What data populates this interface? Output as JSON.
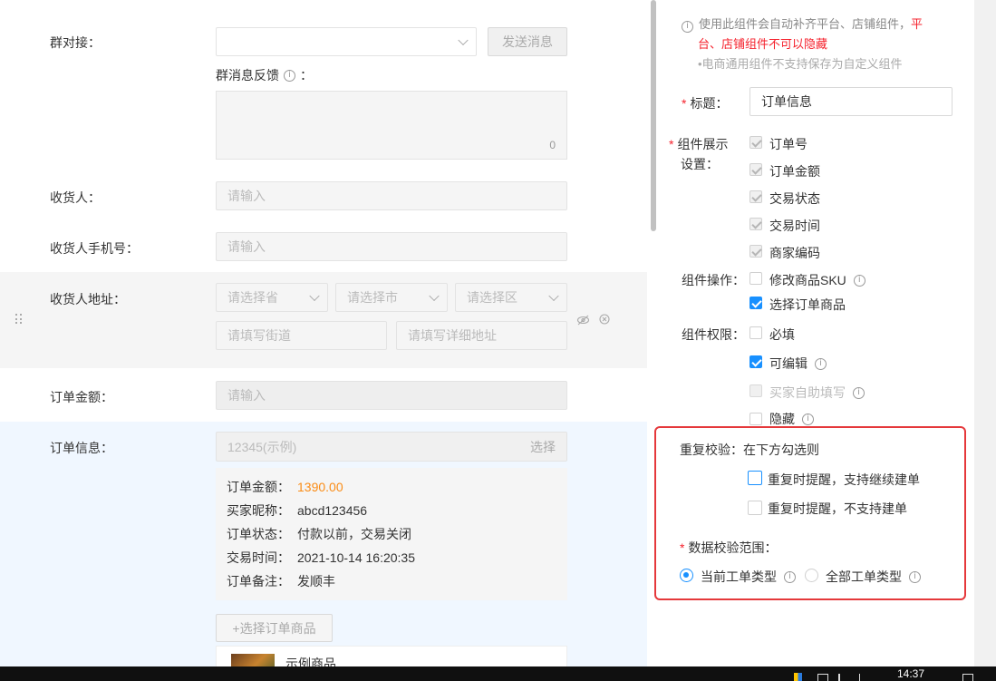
{
  "form": {
    "group_connect": {
      "label": "群对接：",
      "send_button": "发送消息"
    },
    "group_feedback": {
      "label": "群消息反馈",
      "suffix": "：",
      "count": "0"
    },
    "receiver": {
      "label": "收货人：",
      "placeholder": "请输入"
    },
    "receiver_phone": {
      "label": "收货人手机号：",
      "placeholder": "请输入"
    },
    "receiver_address": {
      "label": "收货人地址：",
      "province": "请选择省",
      "city": "请选择市",
      "district": "请选择区",
      "street": "请填写街道",
      "detail": "请填写详细地址"
    },
    "order_amount": {
      "label": "订单金额：",
      "placeholder": "请输入"
    },
    "order_info": {
      "label": "订单信息：",
      "example": "12345(示例)",
      "select": "选择",
      "details": [
        {
          "key": "订单金额：",
          "value": "1390.00"
        },
        {
          "key": "买家昵称：",
          "value": "abcd123456"
        },
        {
          "key": "订单状态：",
          "value": "付款以前，交易关闭"
        },
        {
          "key": "交易时间：",
          "value": "2021-10-14 16:20:35"
        },
        {
          "key": "订单备注：",
          "value": "发顺丰"
        }
      ],
      "select_goods_button": "+选择订单商品",
      "goods_name": "示例商品"
    }
  },
  "panel": {
    "notice1a": "使用此组件会自动补齐平台、店铺组件，",
    "notice1b_red": "平",
    "notice1c_red": "台、店铺组件不可以隐藏",
    "notice2": "•电商通用组件不支持保存为自定义组件",
    "title_label": "标题：",
    "title_value": "订单信息",
    "display_label_1": "组件展示",
    "display_label_2": "设置：",
    "display_items": [
      "订单号",
      "订单金额",
      "交易状态",
      "交易时间",
      "商家编码"
    ],
    "ops_label": "组件操作：",
    "ops_items": [
      "修改商品SKU",
      "选择订单商品"
    ],
    "perm_label": "组件权限：",
    "perm_items": [
      "必填",
      "可编辑",
      "买家自助填写",
      "隐藏"
    ],
    "dup_label": "重复校验：",
    "dup_hint": "在下方勾选则",
    "dup_items": [
      "重复时提醒，支持继续建单",
      "重复时提醒，不支持建单"
    ],
    "scope_label": "数据校验范围：",
    "scope_items": [
      "当前工单类型",
      "全部工单类型"
    ]
  },
  "taskbar": {
    "time": "14:37"
  },
  "colors": {
    "accent": "#1890ff",
    "highlight_border": "#e5383b",
    "amount": "#fa8c16",
    "required": "#f5222d"
  }
}
